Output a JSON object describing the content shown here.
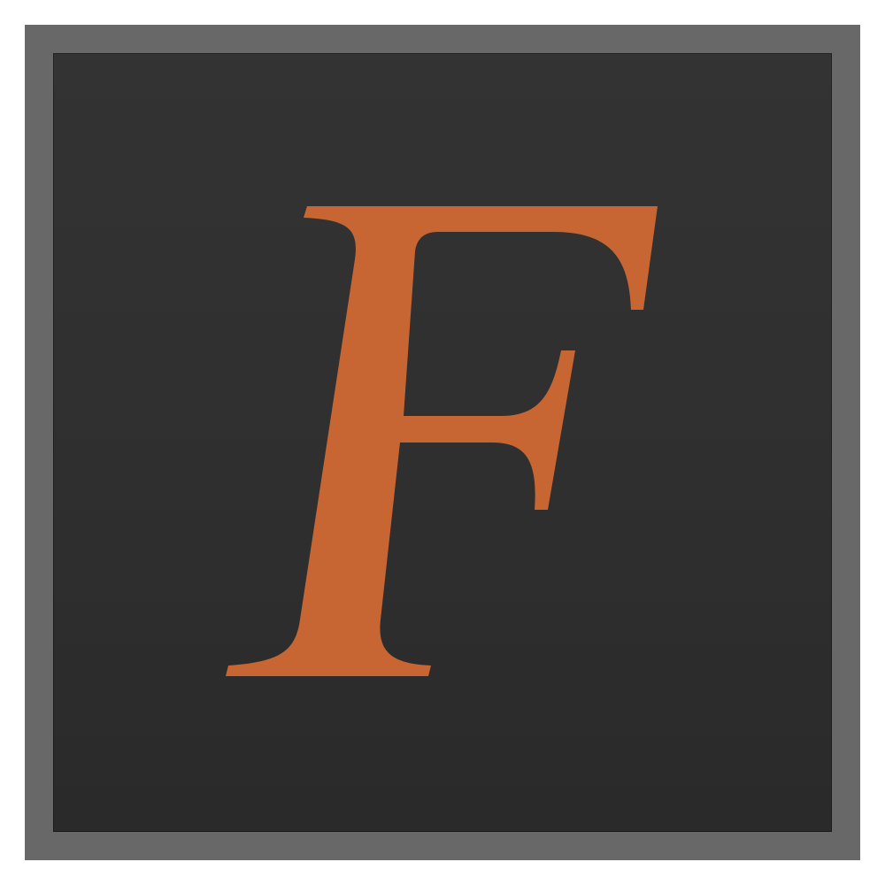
{
  "icon": {
    "name": "app-icon",
    "letter": "F",
    "colors": {
      "border": "#686868",
      "background": "#2e2e2e",
      "letter": "#c76632"
    }
  }
}
